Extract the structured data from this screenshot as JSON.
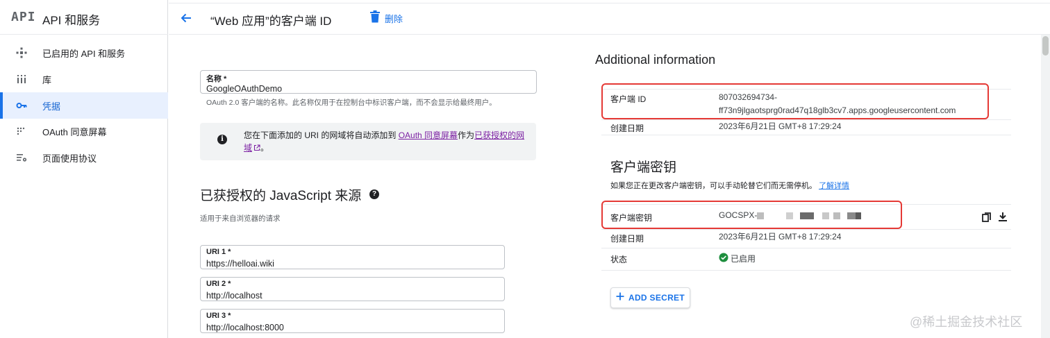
{
  "sidebar": {
    "logo": "API",
    "title": "API 和服务",
    "items": [
      {
        "label": "已启用的 API 和服务",
        "icon": "api-hub-icon",
        "active": false
      },
      {
        "label": "库",
        "icon": "library-icon",
        "active": false
      },
      {
        "label": "凭据",
        "icon": "key-icon",
        "active": true
      },
      {
        "label": "OAuth 同意屏幕",
        "icon": "consent-icon",
        "active": false
      },
      {
        "label": "页面使用协议",
        "icon": "settings-list-icon",
        "active": false
      }
    ]
  },
  "header": {
    "title": "“Web 应用”的客户端 ID",
    "delete_label": "删除"
  },
  "form": {
    "name_label": "名称 *",
    "name_value": "GoogleOAuthDemo",
    "name_hint": "OAuth 2.0 客户端的名称。此名称仅用于在控制台中标识客户端，而不会显示给最终用户。",
    "info_text_1": "您在下面添加的 URI 的网域将自动添加到",
    "info_link_1": "OAuth 同意屏幕",
    "info_text_2": "作为",
    "info_link_2": "已获授权的网域",
    "info_text_3": "。",
    "js_origins_title": "已获授权的 JavaScript 来源",
    "js_origins_hint": "适用于来自浏览器的请求",
    "uris": [
      {
        "label": "URI 1 *",
        "value": "https://helloai.wiki"
      },
      {
        "label": "URI 2 *",
        "value": "http://localhost"
      },
      {
        "label": "URI 3 *",
        "value": "http://localhost:8000"
      }
    ]
  },
  "info_panel": {
    "title": "Additional information",
    "client_id_label": "客户端 ID",
    "client_id_line1": "807032694734-",
    "client_id_line2": "ff73n9jlgaotsprg0rad47q18glb3cv7.apps.googleusercontent.com",
    "created_label": "创建日期",
    "created_value": "2023年6月21日 GMT+8 17:29:24"
  },
  "secret_panel": {
    "title": "客户端密钥",
    "desc": "如果您正在更改客户端密钥，可以手动轮替它们而无需停机。",
    "learn_more": "了解详情",
    "secret_label": "客户端密钥",
    "secret_prefix": "GOCSPX-",
    "created_label": "创建日期",
    "created_value": "2023年6月21日 GMT+8 17:29:24",
    "status_label": "状态",
    "status_value": "已启用",
    "add_secret_label": "ADD SECRET"
  },
  "watermark": "@稀土掘金技术社区",
  "colors": {
    "accent": "#1a73e8",
    "active_bg": "#e8f0fe",
    "highlight_red": "#e53935",
    "status_green": "#1e8e3e",
    "link_purple": "#7b1fa2"
  }
}
